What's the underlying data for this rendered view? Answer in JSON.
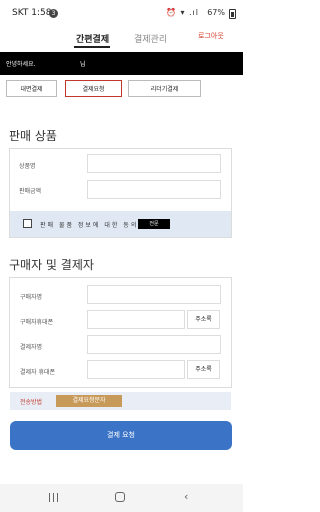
{
  "status_bar": {
    "time": "SKT 1:58",
    "notif_count": "3",
    "indicators": "⏰ ▾ .ıl",
    "battery_pct": "67%"
  },
  "top_nav": {
    "tab_simple": "간편결제",
    "tab_manage": "결제관리",
    "logout": "로그아웃"
  },
  "greeting": {
    "text": "안녕하세요.",
    "suffix": "님"
  },
  "mode_buttons": {
    "face": "대면결제",
    "request": "결제요청",
    "reader": "리더기결제"
  },
  "product": {
    "title": "판매 상품",
    "name_label": "상품명",
    "name_value": "",
    "amount_label": "판매금액",
    "amount_value": "",
    "agree_text": "판매 물품 정보에 대한 동의",
    "agree_button": "전문"
  },
  "buyer": {
    "title": "구매자 및 결제자",
    "buyer_name_label": "구매자명",
    "buyer_phone_label": "구매자휴대폰",
    "payer_name_label": "결제자명",
    "payer_phone_label": "결제자 휴대폰",
    "addr_button": "주소록"
  },
  "send": {
    "label": "전송방법",
    "option": "결제요청문자"
  },
  "submit": {
    "label": "결제 요청"
  },
  "colors": {
    "accent_blue": "#3b74c7",
    "logout_red": "#d23b2b",
    "send_option": "#c79a5a"
  }
}
